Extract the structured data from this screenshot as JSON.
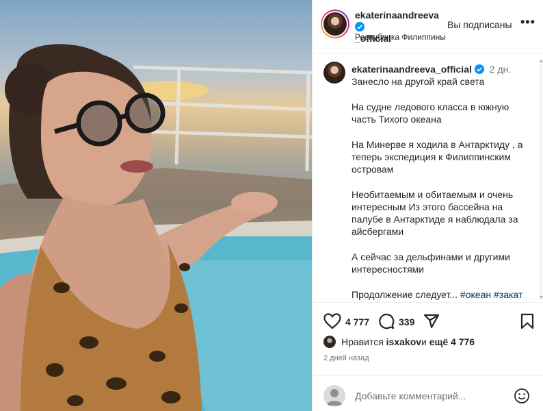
{
  "header": {
    "username_line1": "ekaterinaandreeva",
    "username_line2": "_official",
    "subscribed_label": "Вы подписаны",
    "location": "Республика Филиппины",
    "more_label": "•••"
  },
  "caption": {
    "author": "ekaterinaandreeva_official",
    "age": "2 дн.",
    "paragraphs": [
      "Занесло на другой край света",
      "На судне ледового класса в южную часть Тихого океана",
      "На Минерве я ходила в Антарктиду , а теперь экспедиция к Филиппинским островам",
      "Необитаемым и обитаемым и очень интересным Из этого бассейна на палубе в Антарктиде я наблюдала за айсбергами",
      "А сейчас за дельфинами и другими интересностями"
    ],
    "last_text": "Продолжение следует... ",
    "hashtags": [
      "#океан",
      "#закат"
    ]
  },
  "actions": {
    "like_count": "4 777",
    "comment_count": "339"
  },
  "likes": {
    "prefix": "Нравится ",
    "user": "isxakov",
    "middle": " и ",
    "others": "ещё 4 776"
  },
  "date": "2 дней назад",
  "add_comment": {
    "placeholder": "Добавьте комментарий..."
  },
  "colors": {
    "verified": "#0095f6",
    "link": "#00376b",
    "muted": "#737373",
    "story_ring": [
      "#f9ce34",
      "#ee2a7b",
      "#6228d7"
    ]
  },
  "icons": [
    "heart-icon",
    "comment-icon",
    "share-icon",
    "bookmark-icon",
    "smile-icon",
    "verified-badge-icon",
    "more-icon"
  ]
}
